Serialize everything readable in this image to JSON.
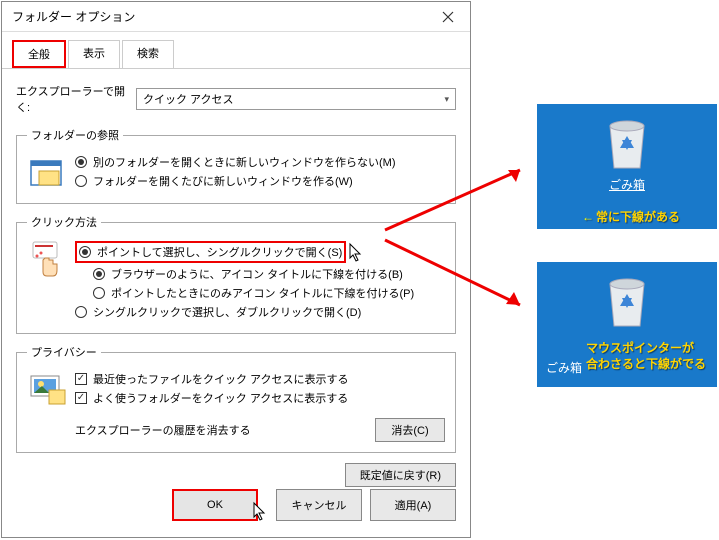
{
  "dialog": {
    "title": "フォルダー オプション"
  },
  "tabs": {
    "general": "全般",
    "view": "表示",
    "search": "検索"
  },
  "explorer": {
    "label": "エクスプローラーで開く:",
    "selected": "クイック アクセス"
  },
  "folderBrowse": {
    "legend": "フォルダーの参照",
    "opt1": "別のフォルダーを開くときに新しいウィンドウを作らない(M)",
    "opt2": "フォルダーを開くたびに新しいウィンドウを作る(W)"
  },
  "clickMethod": {
    "legend": "クリック方法",
    "opt1": "ポイントして選択し、シングルクリックで開く(S)",
    "opt1a": "ブラウザーのように、アイコン タイトルに下線を付ける(B)",
    "opt1b": "ポイントしたときにのみアイコン タイトルに下線を付ける(P)",
    "opt2": "シングルクリックで選択し、ダブルクリックで開く(D)"
  },
  "privacy": {
    "legend": "プライバシー",
    "chk1": "最近使ったファイルをクイック アクセスに表示する",
    "chk2": "よく使うフォルダーをクイック アクセスに表示する",
    "clearLabel": "エクスプローラーの履歴を消去する",
    "clearBtn": "消去(C)"
  },
  "restoreBtn": "既定値に戻す(R)",
  "buttons": {
    "ok": "OK",
    "cancel": "キャンセル",
    "apply": "適用(A)"
  },
  "desktop": {
    "trashLabel": "ごみ箱",
    "anno1": "常に下線がある",
    "anno2a": "マウスポインターが",
    "anno2b": "合わさると下線がでる"
  }
}
